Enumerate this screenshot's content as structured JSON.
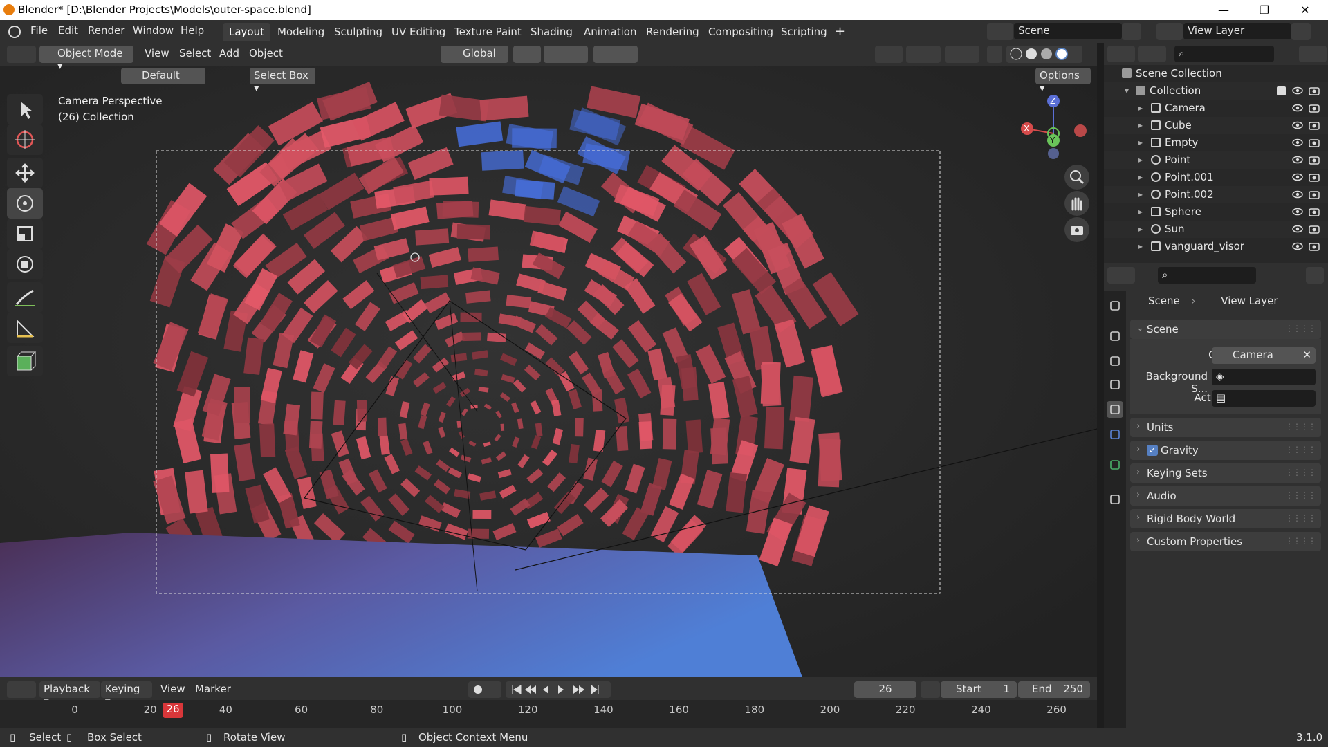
{
  "titlebar": {
    "title": "Blender* [D:\\Blender Projects\\Models\\outer-space.blend]",
    "minimize": "—",
    "maximize": "❐",
    "close": "✕"
  },
  "menus": [
    "File",
    "Edit",
    "Render",
    "Window",
    "Help"
  ],
  "workspaces": [
    "Layout",
    "Modeling",
    "Sculpting",
    "UV Editing",
    "Texture Paint",
    "Shading",
    "Animation",
    "Rendering",
    "Compositing",
    "Scripting"
  ],
  "workspace_add": "+",
  "scene_field": "Scene",
  "view_layer_field": "View Layer",
  "viewport_header": {
    "mode": "Object Mode",
    "menus": [
      "View",
      "Select",
      "Add",
      "Object"
    ],
    "transform_orientation": "Global"
  },
  "tool_settings": {
    "orientation_default": "Default",
    "select_box": "Select Box",
    "options": "Options"
  },
  "viewport": {
    "overlay_line1": "Camera Perspective",
    "overlay_line2": "(26) Collection",
    "gizmo": {
      "z": "Z",
      "y": "Y",
      "x": "X"
    }
  },
  "outliner": {
    "root": "Scene Collection",
    "collection": "Collection",
    "items": [
      {
        "label": "Camera",
        "icon": "camera-icon"
      },
      {
        "label": "Cube",
        "icon": "mesh-icon"
      },
      {
        "label": "Empty",
        "icon": "empty-icon"
      },
      {
        "label": "Point",
        "icon": "light-icon"
      },
      {
        "label": "Point.001",
        "icon": "light-icon"
      },
      {
        "label": "Point.002",
        "icon": "light-icon"
      },
      {
        "label": "Sphere",
        "icon": "mesh-icon"
      },
      {
        "label": "Sun",
        "icon": "light-icon"
      },
      {
        "label": "vanguard_visor",
        "icon": "mesh-icon"
      }
    ]
  },
  "properties": {
    "breadcrumb_scene": "Scene",
    "breadcrumb_view_layer": "View Layer",
    "scene_panel": "Scene",
    "camera_label": "Camera",
    "camera_value": "Camera",
    "background_label": "Background S...",
    "active_clip_label": "Active Clip",
    "panels": [
      "Units",
      "Gravity",
      "Keying Sets",
      "Audio",
      "Rigid Body World",
      "Custom Properties"
    ]
  },
  "timeline": {
    "menus": [
      "Playback",
      "Keying",
      "View",
      "Marker"
    ],
    "current_frame": "26",
    "start_label": "Start",
    "start_value": "1",
    "end_label": "End",
    "end_value": "250",
    "ticks": [
      "0",
      "20",
      "40",
      "60",
      "80",
      "100",
      "120",
      "140",
      "160",
      "180",
      "200",
      "220",
      "240",
      "260"
    ],
    "playhead": "26"
  },
  "statusbar": {
    "select": "Select",
    "box_select": "Box Select",
    "rotate_view": "Rotate View",
    "context_menu": "Object Context Menu",
    "version": "3.1.0"
  },
  "colors": {
    "accent": "#5680c2",
    "playhead": "#d9373a",
    "tunnel": "#e85a6a"
  }
}
